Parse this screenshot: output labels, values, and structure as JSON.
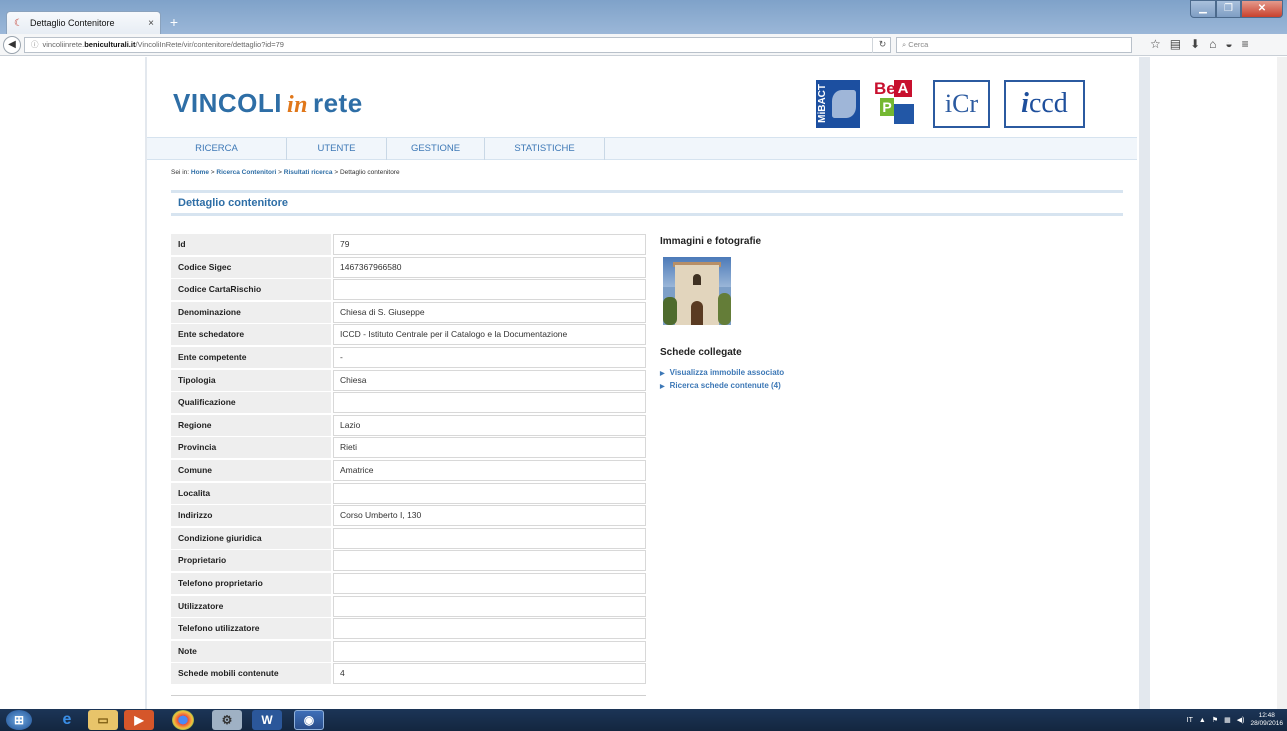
{
  "browser": {
    "tab_title": "Dettaglio Contenitore",
    "url_prefix": "vincoliinrete.",
    "url_host": "beniculturali.it",
    "url_path": "/VincoliInRete/vir/contenitore/dettaglio?id=79",
    "search_placeholder": "Cerca",
    "new_tab": "+",
    "close_tab": "×"
  },
  "site": {
    "logo_left": "VINCOLI",
    "logo_in": "in",
    "logo_right": "rete",
    "partners": {
      "mibac": "MiBACT",
      "beap_1": "Be",
      "beap_2": "A",
      "beap_3": "P",
      "icr": "iCr",
      "iccd_i": "i",
      "iccd_rest": "ccd"
    }
  },
  "menu": [
    "RICERCA",
    "UTENTE",
    "GESTIONE",
    "STATISTICHE"
  ],
  "breadcrumb": {
    "prefix": "Sei in:",
    "home": "Home",
    "ricerca": "Ricerca Contenitori",
    "risultati": "Risultati ricerca",
    "current": "Dettaglio contenitore",
    "sep": ">"
  },
  "section_title": "Dettaglio contenitore",
  "fields": [
    {
      "label": "Id",
      "value": "79"
    },
    {
      "label": "Codice Sigec",
      "value": "1467367966580"
    },
    {
      "label": "Codice CartaRischio",
      "value": ""
    },
    {
      "label": "Denominazione",
      "value": "Chiesa di S. Giuseppe"
    },
    {
      "label": "Ente schedatore",
      "value": "ICCD - Istituto Centrale per il Catalogo e la Documentazione"
    },
    {
      "label": "Ente competente",
      "value": "-"
    },
    {
      "label": "Tipologia",
      "value": "Chiesa"
    },
    {
      "label": "Qualificazione",
      "value": ""
    },
    {
      "label": "Regione",
      "value": "Lazio"
    },
    {
      "label": "Provincia",
      "value": "Rieti"
    },
    {
      "label": "Comune",
      "value": "Amatrice"
    },
    {
      "label": "Localita",
      "value": ""
    },
    {
      "label": "Indirizzo",
      "value": "Corso Umberto I, 130"
    },
    {
      "label": "Condizione giuridica",
      "value": ""
    },
    {
      "label": "Proprietario",
      "value": ""
    },
    {
      "label": "Telefono proprietario",
      "value": ""
    },
    {
      "label": "Utilizzatore",
      "value": ""
    },
    {
      "label": "Telefono utilizzatore",
      "value": ""
    },
    {
      "label": "Note",
      "value": ""
    },
    {
      "label": "Schede mobili contenute",
      "value": "4"
    }
  ],
  "images": {
    "title": "Immagini e fotografie"
  },
  "schede": {
    "title": "Schede collegate",
    "links": [
      "Visualizza immobile associato",
      "Ricerca schede contenute (4)"
    ]
  },
  "taskbar": {
    "lang": "IT",
    "time": "12:48",
    "date": "28/09/2016"
  }
}
